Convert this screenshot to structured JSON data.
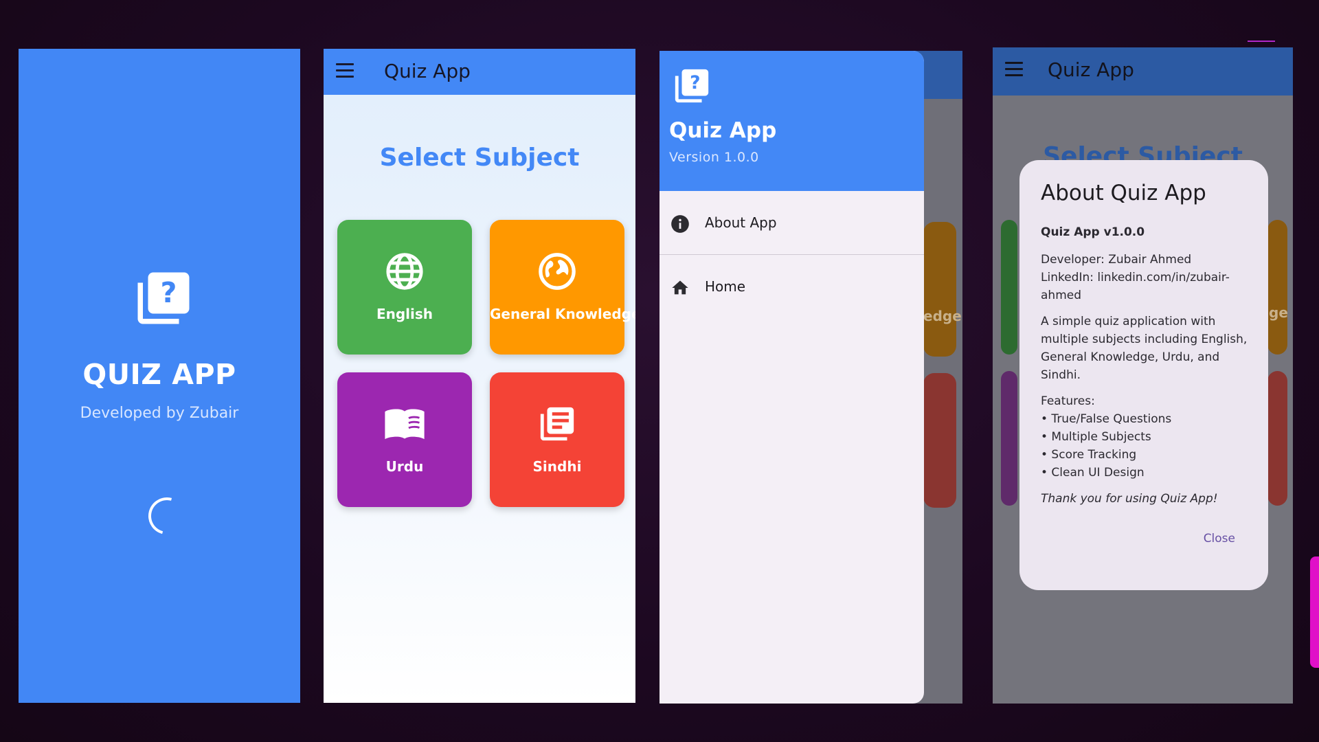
{
  "splash": {
    "title": "QUIZ APP",
    "subtitle": "Developed by Zubair",
    "logo_icon": "quiz-icon",
    "background": "#4287f5"
  },
  "home": {
    "appbar_title": "Quiz App",
    "heading": "Select Subject",
    "subjects": [
      {
        "label": "English",
        "icon": "language-icon",
        "color": "#4caf50"
      },
      {
        "label": "General Knowledge",
        "icon": "public-icon",
        "color": "#ff9800"
      },
      {
        "label": "Urdu",
        "icon": "menu-book-icon",
        "color": "#9c27b0"
      },
      {
        "label": "Sindhi",
        "icon": "library-books-icon",
        "color": "#f44336"
      }
    ]
  },
  "drawer": {
    "title": "Quiz App",
    "version": "Version 1.0.0",
    "items": [
      {
        "label": "About App",
        "icon": "info-icon"
      },
      {
        "label": "Home",
        "icon": "home-icon"
      }
    ],
    "background_text": "edge"
  },
  "dialog": {
    "appbar_title": "Quiz App",
    "background_heading": "Select Subject",
    "background_tile_text": "ge",
    "title": "About Quiz App",
    "version_line": "Quiz App v1.0.0",
    "developer": "Developer: Zubair Ahmed",
    "linkedin": "LinkedIn: linkedin.com/in/zubair-ahmed",
    "description": "A simple quiz application with multiple subjects including English, General Knowledge, Urdu, and Sindhi.",
    "features_label": "Features:",
    "features": [
      "• True/False Questions",
      "• Multiple Subjects",
      "• Score Tracking",
      "• Clean UI Design"
    ],
    "thanks": "Thank you for using Quiz App!",
    "close_label": "Close"
  }
}
